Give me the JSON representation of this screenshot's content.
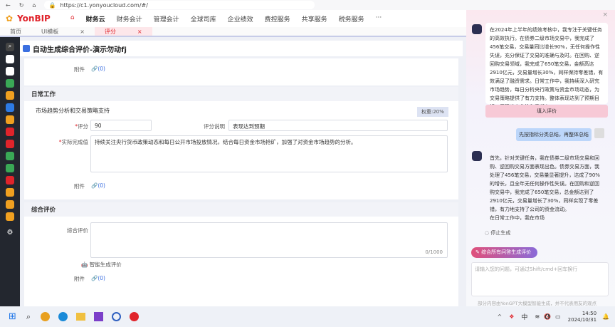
{
  "browser": {
    "url": "https://c1.yonyoucloud.com/#/"
  },
  "header": {
    "brand": "YonBIP",
    "nav": [
      "财务云",
      "财务会计",
      "管理会计",
      "全球司库",
      "企业绩效",
      "费控服务",
      "共享服务",
      "税务服务",
      "···"
    ]
  },
  "tabs": [
    {
      "label": "首页"
    },
    {
      "label": "UI模板"
    },
    {
      "label": "评分"
    }
  ],
  "page": {
    "title": "自动生成综合评价-演示勿动fj"
  },
  "form": {
    "attachment_label": "附件",
    "attachment_count": "(0)",
    "section_daily": "日常工作",
    "task_name": "市场趋势分析和交易策略支持",
    "weight": "权重:20%",
    "score_label": "评分",
    "score_value": "90",
    "score_desc_label": "评分说明",
    "score_desc_value": "表现达到预期",
    "actual_label": "实际完成值",
    "actual_value": "持续关注央行货币政策动态和每日公开市场投放情况，结合每日资金市场抢矿，加强了对资金市场趋势的分析。",
    "section_overall": "综合评价",
    "overall_label": "综合评价",
    "overall_count": "0/1000",
    "smart_gen": "智能生成评价"
  },
  "assistant": {
    "msg1": "在2024年上半年的绩效考核中，我专注于关键任务的高效执行。在债券二级市场交易中，我完成了456笔交易，交易量同比增长90%，无任何操作性失误，充分保证了交易的准确与及时。在回购、逆回购交易领域，我完成了650笔交易，金额高达2910亿元，交易量增长30%，同样保持零差错，有效满足了融资需求。日常工作中，我持续深入研究市场趋势，每日分析央行政策与资金市场动态，为交易策略提供了有力支持。整体表现达到了预期目标，展现出专业性和责任心。",
    "fill_btn": "填入评价",
    "user_msg": "先按指标分类总结，再整体总结",
    "msg2": "首先，针对关键任务，我在债券二级市场交易和回购、逆回购交易方面表现出色。债券交易方面，我处理了456笔交易，交易量显著提升，达成了90%的增长，且全年无任何操作性失误。在回购和逆回购交易中，我完成了650笔交易，总金额达到了2910亿元，交易量增长了30%，同样实现了零差错，有力地支持了公司的资金流动。",
    "msg2b": "在日常工作中，我在市场",
    "stop": "停止生成",
    "gen_all": "综合所有问答生成评价",
    "input_placeholder": "请输入您的问题，可通过Shift/cmd+回车换行",
    "disclaimer": "部分内容由YonGPT大模型智能生成，并不代表用友的观点"
  },
  "taskbar": {
    "time": "14:50",
    "date": "2024/10/31",
    "ime": "中"
  },
  "colors": {
    "brand": "#e0242b",
    "sidebar": "#23272f",
    "accent": "#7b61c9"
  }
}
